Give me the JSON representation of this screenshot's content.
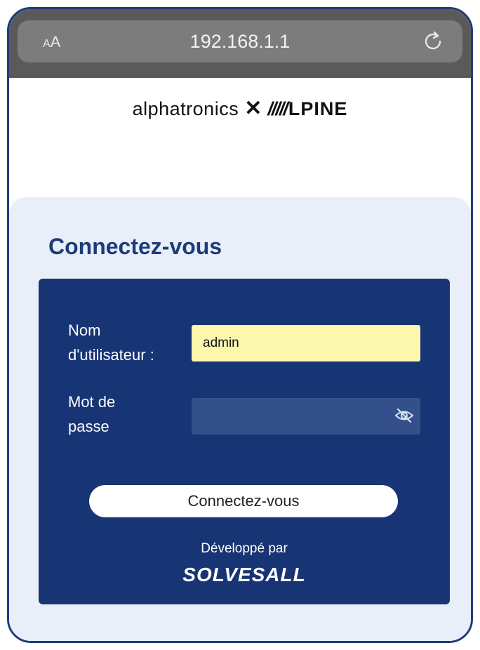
{
  "browser": {
    "text_size_small": "A",
    "text_size_big": "A",
    "url": "192.168.1.1",
    "reload_icon": "reload-icon"
  },
  "brand": {
    "alpha": "alphatronics",
    "x": "✕",
    "stripes": "/////",
    "alpine": "LPINE"
  },
  "login": {
    "title": "Connectez-vous",
    "username_label_line1": "Nom",
    "username_label_line2": "d'utilisateur :",
    "username_value": "admin",
    "password_label_line1": "Mot de",
    "password_label_line2": "passe",
    "password_value": "",
    "password_toggle_icon": "eye-slash-icon",
    "submit_label": "Connectez-vous",
    "developed_by": "Développé par",
    "developer": "SOLVESALL"
  },
  "colors": {
    "brand_blue": "#173474",
    "title_blue": "#1b3c78",
    "username_bg": "#fbf8ad",
    "panel_bg": "#e9eff8"
  }
}
